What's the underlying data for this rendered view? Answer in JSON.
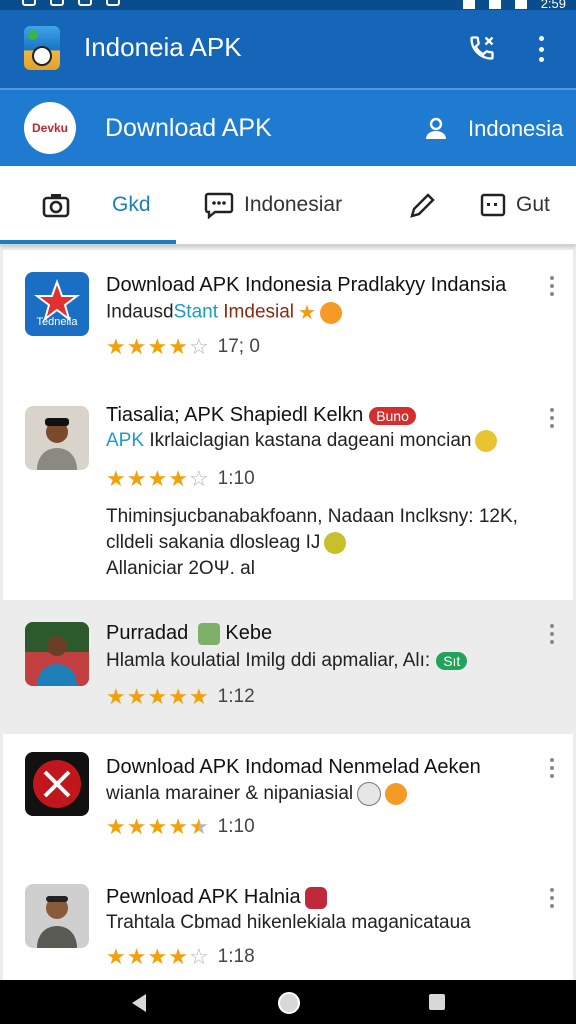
{
  "status": {
    "time": "2:59"
  },
  "app": {
    "title": "Indoneia APK"
  },
  "subheader": {
    "brand": "Devku",
    "title": "Download APK",
    "region": "Indonesia"
  },
  "tabs": [
    {
      "label": "Gkd",
      "icon": "camera-icon"
    },
    {
      "label": "Indonesiar",
      "icon": "chat-icon"
    },
    {
      "label": "",
      "icon": "edit-icon"
    },
    {
      "label": "Gut",
      "icon": "window-icon"
    }
  ],
  "apps": [
    {
      "title": "Download APK Indonesia Pradlakyy Indansia",
      "thumb_label": "Tedneila",
      "desc_a": "Indausd",
      "desc_b": "Stant",
      "desc_c": "Imdesial",
      "rating": 4,
      "rating_text": "17; 0"
    },
    {
      "title": "Tiasalia; APK Shapiedl Kelkn",
      "badge": "Buno",
      "desc_b": "APK",
      "desc_c": "Ikrlaiclagian kastana dageani moncian",
      "rating": 4,
      "rating_text": "1:10",
      "extra_1": "Thiminsjucbanabakfoann, Nadaan Inclksny: 12K,",
      "extra_2": "clldeli sakania dlosleag IJ",
      "extra_3": "Allaniciar 2OΨ. al"
    },
    {
      "title": "Purradad",
      "title_b": "Kebe",
      "desc_a": "Hlamla koulatial Imilg ddi apmaliar, Alı:",
      "badge": "Sıt",
      "rating": 5,
      "rating_text": "1:12"
    },
    {
      "title": "Download APK Indomad Nenmelad Aeken",
      "desc_a": "wianla marainer & nipaniasial",
      "rating": 4.5,
      "rating_text": "1:10"
    },
    {
      "title": "Pewnload APK Halnia",
      "desc_a": "Trahtala Cbmad hikenlekiala maganicataua",
      "rating": 4,
      "rating_text": "1:18"
    }
  ]
}
